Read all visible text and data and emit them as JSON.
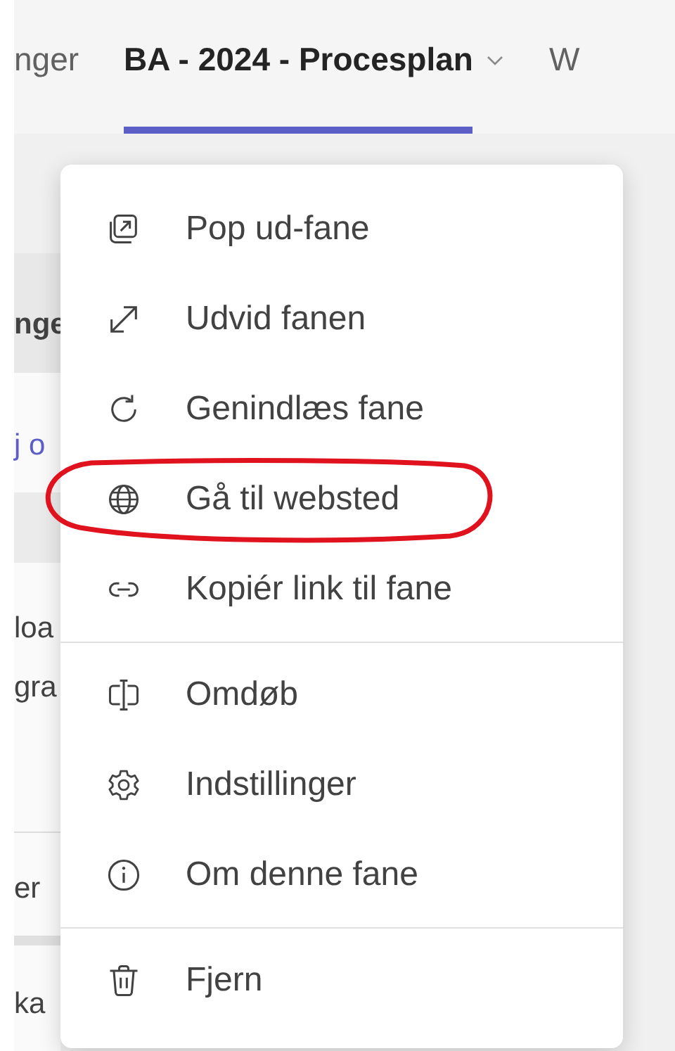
{
  "tabs": [
    {
      "label": "nger",
      "selected": false
    },
    {
      "label": "BA - 2024 - Procesplan",
      "selected": true,
      "dropdown": true
    },
    {
      "label": "W",
      "selected": false
    }
  ],
  "background_fragments": [
    {
      "kind": "header",
      "text": "nge"
    },
    {
      "kind": "link",
      "text": "j o"
    },
    {
      "kind": "text",
      "text": "loa"
    },
    {
      "kind": "text",
      "text": "gra"
    },
    {
      "kind": "text",
      "text": "er"
    },
    {
      "kind": "text",
      "text": "ka"
    }
  ],
  "menu": {
    "groups": [
      [
        {
          "label": "Pop ud-fane",
          "highlighted": false
        },
        {
          "label": "Udvid fanen",
          "highlighted": false
        },
        {
          "label": "Genindlæs fane",
          "highlighted": false
        },
        {
          "label": "Gå til websted",
          "highlighted": true
        },
        {
          "label": "Kopiér link til fane",
          "highlighted": false
        }
      ],
      [
        {
          "label": "Omdøb",
          "highlighted": false
        },
        {
          "label": "Indstillinger",
          "highlighted": false
        },
        {
          "label": "Om denne fane",
          "highlighted": false
        }
      ],
      [
        {
          "label": "Fjern",
          "highlighted": false
        }
      ]
    ]
  }
}
